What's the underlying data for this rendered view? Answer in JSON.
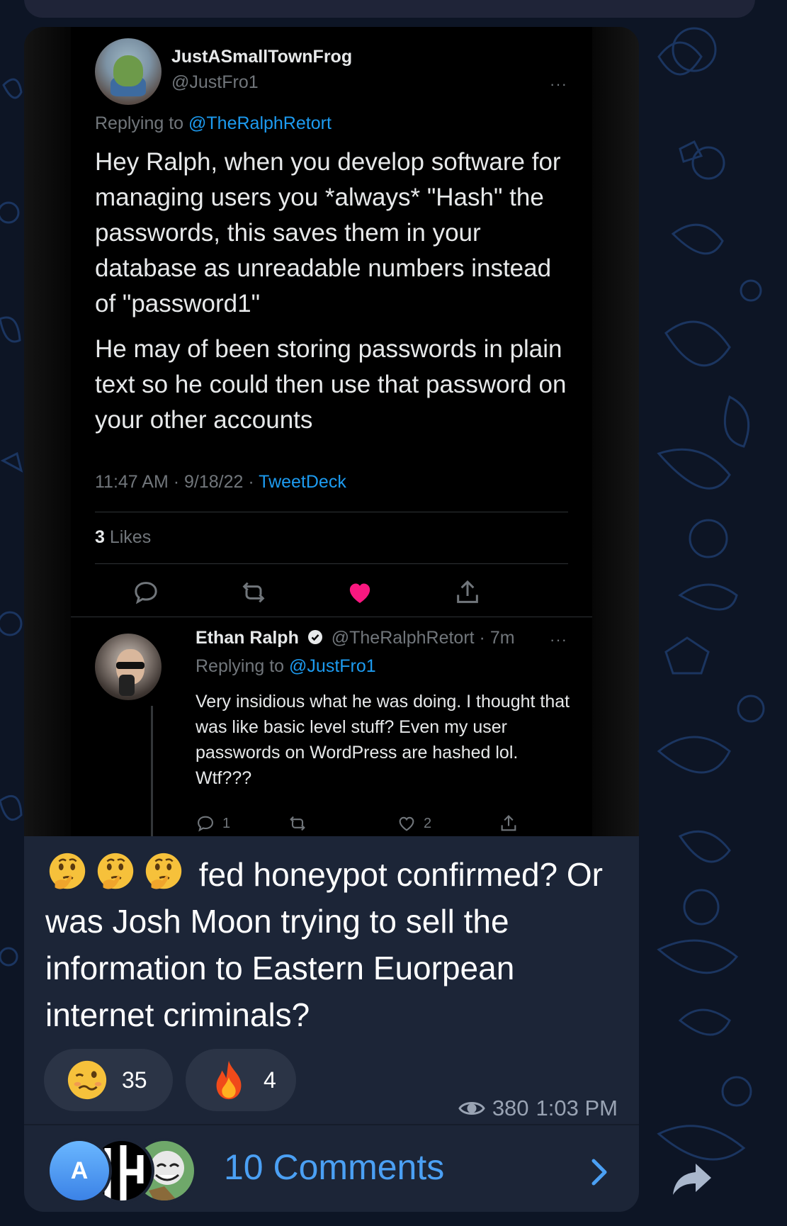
{
  "tweet": {
    "author_name": "JustASmallTownFrog",
    "author_handle": "@JustFro1",
    "more": "···",
    "replying_prefix": "Replying to ",
    "replying_to": "@TheRalphRetort",
    "body_p1": "Hey Ralph, when you develop software for managing users you *always* \"Hash\" the passwords, this saves them in your database as unreadable numbers instead of \"password1\"",
    "body_p2": "He may of been storing passwords in plain text so he could then use that password on your other accounts",
    "meta_time": "11:47 AM · 9/18/22 · ",
    "meta_source": "TweetDeck",
    "likes_count": "3",
    "likes_label": " Likes"
  },
  "reply": {
    "author_name": "Ethan Ralph",
    "author_handle": "@TheRalphRetort · 7m",
    "more": "···",
    "replying_prefix": "Replying to ",
    "replying_to": "@JustFro1",
    "body": "Very insidious what he was doing. I thought that was like basic level stuff? Even my user passwords on WordPress are hashed lol. Wtf???",
    "reply_count": "1",
    "like_count": "2"
  },
  "message": {
    "caption": "fed honeypot confirmed? Or was Josh Moon trying to sell the information to Eastern Euorpean internet criminals?",
    "caption_emojis": [
      "thinking-face",
      "thinking-face",
      "thinking-face"
    ],
    "reactions": [
      {
        "emoji": "woozy-face",
        "count": "35"
      },
      {
        "emoji": "fire",
        "count": "4"
      }
    ],
    "views": "380",
    "time": "1:03 PM"
  },
  "comments": {
    "avatar_letter": "A",
    "label": "10 Comments"
  },
  "colors": {
    "bubble": "#1c2537",
    "twitter_blue": "#1d9bf0",
    "like_pink": "#f91880",
    "comments_blue": "#4ba0f4"
  }
}
